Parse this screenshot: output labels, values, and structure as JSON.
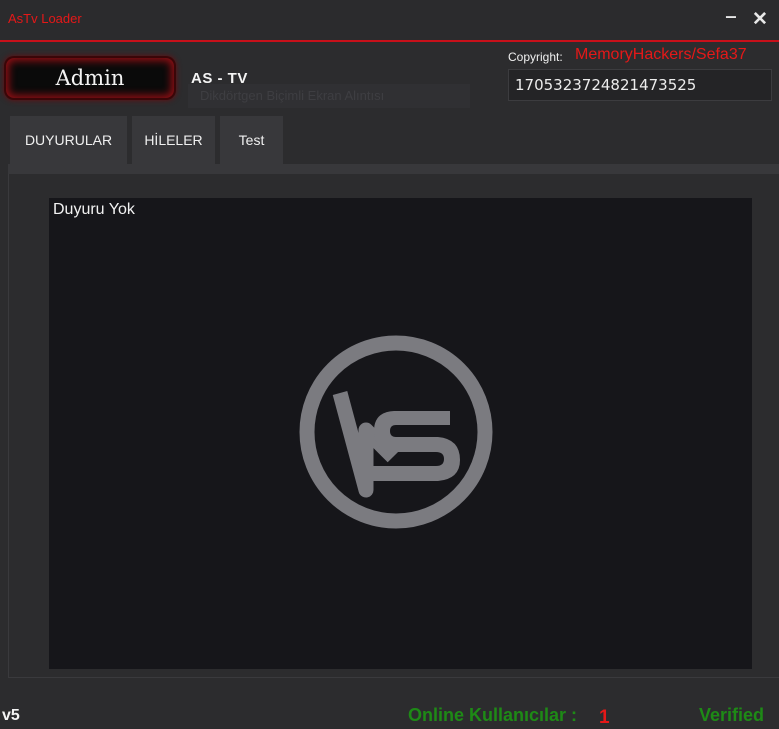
{
  "window": {
    "title": "AsTv Loader",
    "minimize_glyph": "‒",
    "close_glyph": "✕"
  },
  "header": {
    "user_button_label": "Admin",
    "app_name": "AS - TV",
    "ghost_text": "Dikdörtgen Biçimli Ekran Alıntısı",
    "copyright_label": "Copyright:",
    "copyright_value": "MemoryHackers/Sefa37",
    "id_value": "1705323724821473525"
  },
  "tabs": [
    {
      "label": "DUYURULAR",
      "active": true
    },
    {
      "label": "HİLELER",
      "active": false
    },
    {
      "label": "Test",
      "active": false
    }
  ],
  "content": {
    "announcement_text": "Duyuru Yok",
    "logo_icon": "as-logo-icon",
    "logo_color": "#7b7b80",
    "panel_bg": "#16161a"
  },
  "footer": {
    "version": "v5",
    "online_label": "Online Kullanıcılar :",
    "online_count": "1",
    "status": "Verified"
  },
  "colors": {
    "accent_red": "#e51818",
    "success_green": "#1e8a16",
    "window_bg": "#2c2c2e"
  }
}
